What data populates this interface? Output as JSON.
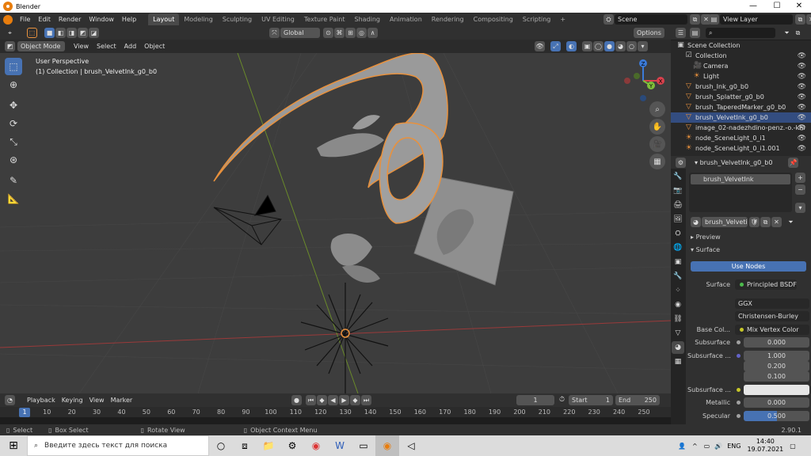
{
  "window": {
    "title": "Blender",
    "minimize": "—",
    "maximize": "☐",
    "close": "✕"
  },
  "menu": [
    "File",
    "Edit",
    "Render",
    "Window",
    "Help"
  ],
  "workspaces": [
    {
      "label": "Layout",
      "active": true
    },
    {
      "label": "Modeling"
    },
    {
      "label": "Sculpting"
    },
    {
      "label": "UV Editing"
    },
    {
      "label": "Texture Paint"
    },
    {
      "label": "Shading"
    },
    {
      "label": "Animation"
    },
    {
      "label": "Rendering"
    },
    {
      "label": "Compositing"
    },
    {
      "label": "Scripting"
    }
  ],
  "add_workspace": "+",
  "scene": {
    "name": "Scene",
    "view_layer": "View Layer"
  },
  "viewport_header": {
    "mode": "Object Mode",
    "menus": [
      "View",
      "Select",
      "Add",
      "Object"
    ],
    "orientation": "Global",
    "options": "Options"
  },
  "viewport": {
    "perspective": "User Perspective",
    "collection_info": "(1) Collection | brush_VelvetInk_g0_b0"
  },
  "gizmo": {
    "x": "X",
    "y": "Y",
    "z": "Z"
  },
  "timeline": {
    "menus": [
      "Playback",
      "Keying",
      "View",
      "Marker"
    ],
    "current_frame": "1",
    "start_label": "Start",
    "start": "1",
    "end_label": "End",
    "end": "250",
    "ticks": [
      "1",
      "10",
      "20",
      "30",
      "40",
      "50",
      "60",
      "70",
      "80",
      "90",
      "100",
      "110",
      "120",
      "130",
      "140",
      "150",
      "160",
      "170",
      "180",
      "190",
      "200",
      "210",
      "220",
      "230",
      "240",
      "250"
    ]
  },
  "status": {
    "select": "Select",
    "box_select": "Box Select",
    "rotate_view": "Rotate View",
    "context_menu": "Object Context Menu",
    "version": "2.90.1"
  },
  "outliner": {
    "rows": [
      {
        "label": "Scene Collection",
        "indent": 0,
        "icon": "scene-collection-icon",
        "sel": false
      },
      {
        "label": "Collection",
        "indent": 1,
        "icon": "collection-icon",
        "sel": false
      },
      {
        "label": "Camera",
        "indent": 2,
        "icon": "camera-icon",
        "sel": false
      },
      {
        "label": "Light",
        "indent": 2,
        "icon": "light-icon",
        "sel": false
      },
      {
        "label": "brush_Ink_g0_b0",
        "indent": 1,
        "icon": "mesh-icon",
        "sel": false
      },
      {
        "label": "brush_Splatter_g0_b0",
        "indent": 1,
        "icon": "mesh-icon",
        "sel": false
      },
      {
        "label": "brush_TaperedMarker_g0_b0",
        "indent": 1,
        "icon": "mesh-icon",
        "sel": false
      },
      {
        "label": "brush_VelvetInk_g0_b0",
        "indent": 1,
        "icon": "mesh-icon",
        "sel": true
      },
      {
        "label": "image_02-nadezhdino-penz.-o.-khi",
        "indent": 1,
        "icon": "mesh-icon",
        "sel": false
      },
      {
        "label": "node_SceneLight_0_i1",
        "indent": 1,
        "icon": "light-icon",
        "sel": false
      },
      {
        "label": "node_SceneLight_0_i1.001",
        "indent": 1,
        "icon": "light-icon",
        "sel": false
      }
    ]
  },
  "properties": {
    "object_name": "brush_VelvetInk_g0_b0",
    "material_slot": "brush_VelvetInk",
    "material_name": "brush_Velveti...",
    "panel_preview": "Preview",
    "panel_surface": "Surface",
    "use_nodes": "Use Nodes",
    "surface_label": "Surface",
    "surface_value": "Principled BSDF",
    "distribution": "GGX",
    "subsurface_method": "Christensen-Burley",
    "base_color_label": "Base Col...",
    "base_color_value": "Mix Vertex Color",
    "subsurface_label": "Subsurface",
    "subsurface_value": "0.000",
    "subsurface_radius_label": "Subsurface ...",
    "radius": [
      "1.000",
      "0.200",
      "0.100"
    ],
    "subsurface_color_label": "Subsurface ...",
    "metallic_label": "Metallic",
    "metallic_value": "0.000",
    "specular_label": "Specular",
    "specular_value": "0.500",
    "specular_fraction": 0.5
  },
  "taskbar": {
    "search_placeholder": "Введите здесь текст для поиска",
    "lang": "ENG",
    "time": "14:40",
    "date": "19.07.2021"
  },
  "colors": {
    "accent": "#4772b3",
    "selection": "#e8913d",
    "bg": "#3d3d3d"
  }
}
